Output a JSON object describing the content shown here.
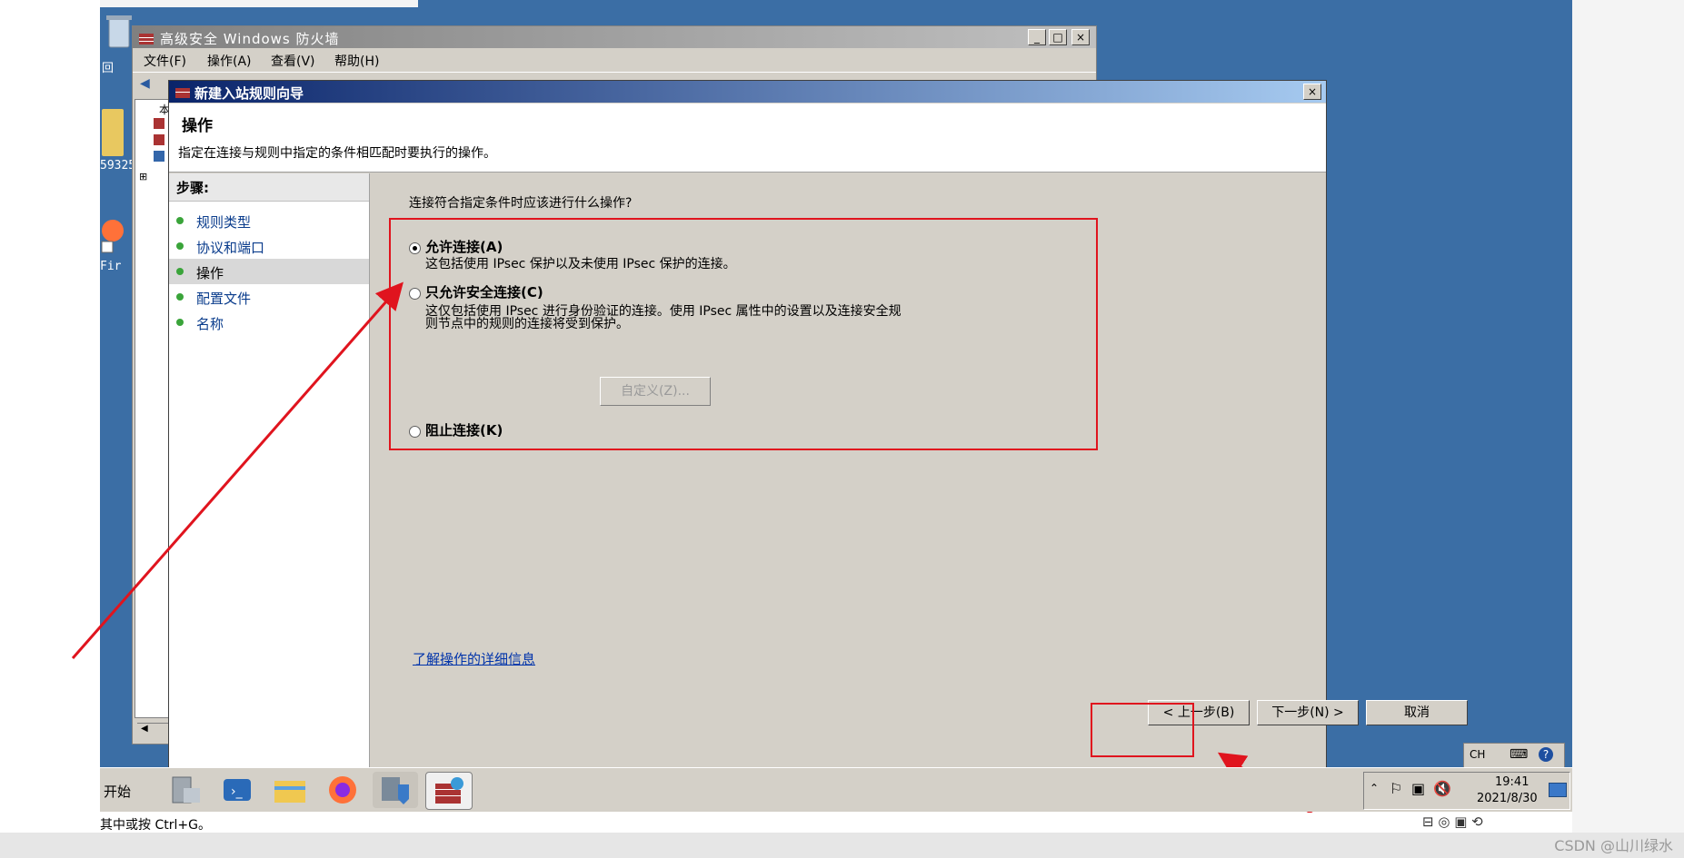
{
  "mmc": {
    "title": "高级安全 Windows 防火墙",
    "menu": [
      "文件(F)",
      "操作(A)",
      "查看(V)",
      "帮助(H)"
    ],
    "tree_label": "本"
  },
  "desktop": {
    "icon_labels": [
      "回",
      "59325",
      "Fir"
    ]
  },
  "wizard": {
    "title": "新建入站规则向导",
    "header": "操作",
    "header_desc": "指定在连接与规则中指定的条件相匹配时要执行的操作。",
    "steps_title": "步骤:",
    "steps": [
      "规则类型",
      "协议和端口",
      "操作",
      "配置文件",
      "名称"
    ],
    "active_step": 2,
    "question": "连接符合指定条件时应该进行什么操作?",
    "options": [
      {
        "label": "允许连接(A)",
        "desc": "这包括使用 IPsec 保护以及未使用 IPsec 保护的连接。",
        "selected": true
      },
      {
        "label": "只允许安全连接(C)",
        "desc1": "这仅包括使用 IPsec 进行身份验证的连接。使用 IPsec 属性中的设置以及连接安全规",
        "desc2": "则节点中的规则的连接将受到保护。",
        "selected": false
      },
      {
        "label": "阻止连接(K)",
        "selected": false
      }
    ],
    "customize_label": "自定义(Z)...",
    "learn_more": "了解操作的详细信息",
    "back_label": "< 上一步(B)",
    "next_label": "下一步(N) >",
    "cancel_label": "取消"
  },
  "taskbar": {
    "start_label": "开始",
    "time": "19:41",
    "date": "2021/8/30",
    "lang": "CH"
  },
  "status_text": "其中或按 Ctrl+G。",
  "watermark": "CSDN @山川绿水",
  "colors": {
    "highlight": "#e0141e",
    "desktop": "#3b6ea5",
    "dialog": "#d4d0c8"
  }
}
